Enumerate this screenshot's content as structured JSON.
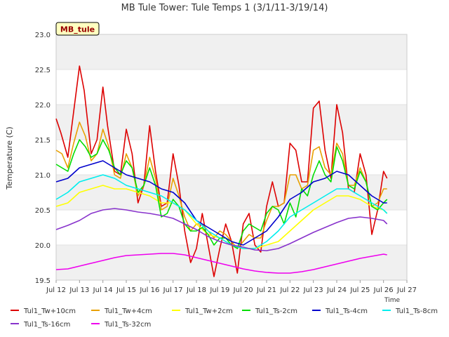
{
  "chart_data": {
    "type": "line",
    "title": "MB Tule Tower: Tule Temps 1 (3/1/11-3/19/14)",
    "xlabel": "Time",
    "ylabel": "Temperature (C)",
    "station_tag": "MB_tule",
    "xlim": [
      12,
      27
    ],
    "ylim": [
      19.5,
      23.0
    ],
    "x_ticks": [
      12,
      13,
      14,
      15,
      16,
      17,
      18,
      19,
      20,
      21,
      22,
      23,
      24,
      25,
      26,
      27
    ],
    "x_tick_labels": [
      "Jul 12",
      "Jul 13",
      "Jul 14",
      "Jul 15",
      "Jul 16",
      "Jul 17",
      "Jul 18",
      "Jul 19",
      "Jul 20",
      "Jul 21",
      "Jul 22",
      "Jul 23",
      "Jul 24",
      "Jul 25",
      "Jul 26",
      "Jul 27"
    ],
    "y_ticks": [
      19.5,
      20.0,
      20.5,
      21.0,
      21.5,
      22.0,
      22.5,
      23.0
    ],
    "y_tick_labels": [
      "19.5",
      "20.0",
      "20.5",
      "21.0",
      "21.5",
      "22.0",
      "22.5",
      "23.0"
    ],
    "grid": true,
    "legend_position": "bottom",
    "series": [
      {
        "name": "Tul1_Tw+10cm",
        "color": "#dd0000",
        "x": [
          12.0,
          12.2,
          12.5,
          12.75,
          13.0,
          13.2,
          13.5,
          13.75,
          14.0,
          14.2,
          14.5,
          14.75,
          15.0,
          15.25,
          15.5,
          15.75,
          16.0,
          16.25,
          16.5,
          16.75,
          17.0,
          17.25,
          17.5,
          17.75,
          18.0,
          18.25,
          18.5,
          18.75,
          19.0,
          19.25,
          19.5,
          19.75,
          20.0,
          20.25,
          20.5,
          20.75,
          21.0,
          21.25,
          21.5,
          21.75,
          22.0,
          22.25,
          22.5,
          22.75,
          23.0,
          23.25,
          23.5,
          23.75,
          24.0,
          24.25,
          24.5,
          24.75,
          25.0,
          25.25,
          25.5,
          25.75,
          26.0,
          26.15
        ],
        "y": [
          21.8,
          21.6,
          21.25,
          21.9,
          22.55,
          22.2,
          21.3,
          21.5,
          22.25,
          21.7,
          21.05,
          21.0,
          21.65,
          21.3,
          20.6,
          20.85,
          21.7,
          21.05,
          20.55,
          20.6,
          21.3,
          20.85,
          20.2,
          19.75,
          19.95,
          20.45,
          20.0,
          19.55,
          19.95,
          20.3,
          20.05,
          19.6,
          20.3,
          20.45,
          20.0,
          19.9,
          20.55,
          20.9,
          20.55,
          20.6,
          21.45,
          21.35,
          20.9,
          20.9,
          21.95,
          22.05,
          21.35,
          20.95,
          22.0,
          21.6,
          20.8,
          20.75,
          21.3,
          21.0,
          20.15,
          20.5,
          21.05,
          20.95
        ]
      },
      {
        "name": "Tul1_Tw+4cm",
        "color": "#e8a000",
        "x": [
          12.0,
          12.25,
          12.5,
          12.75,
          13.0,
          13.25,
          13.5,
          13.75,
          14.0,
          14.25,
          14.5,
          14.75,
          15.0,
          15.25,
          15.5,
          15.75,
          16.0,
          16.25,
          16.5,
          16.75,
          17.0,
          17.25,
          17.5,
          17.75,
          18.0,
          18.25,
          18.5,
          18.75,
          19.0,
          19.25,
          19.5,
          19.75,
          20.0,
          20.25,
          20.5,
          20.75,
          21.0,
          21.25,
          21.5,
          21.75,
          22.0,
          22.25,
          22.5,
          22.75,
          23.0,
          23.25,
          23.5,
          23.75,
          24.0,
          24.25,
          24.5,
          24.75,
          25.0,
          25.25,
          25.5,
          25.75,
          26.0,
          26.15
        ],
        "y": [
          21.35,
          21.3,
          21.1,
          21.45,
          21.75,
          21.55,
          21.2,
          21.3,
          21.65,
          21.4,
          21.0,
          20.95,
          21.3,
          21.1,
          20.7,
          20.85,
          21.25,
          20.95,
          20.5,
          20.55,
          20.95,
          20.7,
          20.4,
          20.2,
          20.3,
          20.3,
          20.2,
          20.1,
          20.2,
          20.15,
          20.05,
          19.95,
          20.05,
          20.15,
          20.1,
          20.1,
          20.35,
          20.55,
          20.55,
          20.6,
          21.0,
          21.0,
          20.8,
          20.85,
          21.35,
          21.4,
          21.1,
          21.0,
          21.45,
          21.3,
          20.85,
          20.85,
          21.1,
          20.9,
          20.55,
          20.6,
          20.8,
          20.8
        ]
      },
      {
        "name": "Tul1_Tw+2cm",
        "color": "#ffff00",
        "x": [
          12.0,
          12.5,
          13.0,
          13.5,
          14.0,
          14.5,
          15.0,
          15.5,
          16.0,
          16.5,
          17.0,
          17.5,
          18.0,
          18.5,
          19.0,
          19.5,
          20.0,
          20.5,
          21.0,
          21.5,
          22.0,
          22.5,
          23.0,
          23.5,
          24.0,
          24.5,
          25.0,
          25.5,
          26.0,
          26.15
        ],
        "y": [
          20.55,
          20.6,
          20.75,
          20.8,
          20.85,
          20.8,
          20.8,
          20.75,
          20.7,
          20.6,
          20.6,
          20.5,
          20.3,
          20.15,
          20.1,
          20.0,
          19.95,
          19.95,
          20.0,
          20.05,
          20.2,
          20.35,
          20.5,
          20.6,
          20.7,
          20.7,
          20.65,
          20.55,
          20.5,
          20.45
        ]
      },
      {
        "name": "Tul1_Ts-2cm",
        "color": "#00dd00",
        "x": [
          12.0,
          12.25,
          12.5,
          12.75,
          13.0,
          13.25,
          13.5,
          13.75,
          14.0,
          14.25,
          14.5,
          14.75,
          15.0,
          15.25,
          15.5,
          15.75,
          16.0,
          16.25,
          16.5,
          16.75,
          17.0,
          17.25,
          17.5,
          17.75,
          18.0,
          18.25,
          18.5,
          18.75,
          19.0,
          19.25,
          19.5,
          19.75,
          20.0,
          20.25,
          20.5,
          20.75,
          21.0,
          21.25,
          21.5,
          21.75,
          22.0,
          22.25,
          22.5,
          22.75,
          23.0,
          23.25,
          23.5,
          23.75,
          24.0,
          24.25,
          24.5,
          24.75,
          25.0,
          25.25,
          25.5,
          25.75,
          26.0,
          26.15
        ],
        "y": [
          21.15,
          21.1,
          21.05,
          21.3,
          21.5,
          21.4,
          21.25,
          21.3,
          21.5,
          21.35,
          21.1,
          21.0,
          21.2,
          21.1,
          20.75,
          20.85,
          21.1,
          20.85,
          20.4,
          20.45,
          20.65,
          20.55,
          20.3,
          20.2,
          20.2,
          20.25,
          20.15,
          20.0,
          20.1,
          20.1,
          20.0,
          19.95,
          20.2,
          20.3,
          20.25,
          20.2,
          20.45,
          20.55,
          20.5,
          20.3,
          20.6,
          20.4,
          20.8,
          20.7,
          21.0,
          21.2,
          21.0,
          20.9,
          21.4,
          21.2,
          20.85,
          20.8,
          21.05,
          20.9,
          20.55,
          20.5,
          20.6,
          20.65
        ]
      },
      {
        "name": "Tul1_Ts-4cm",
        "color": "#0000cc",
        "x": [
          12.0,
          12.5,
          13.0,
          13.5,
          14.0,
          14.5,
          15.0,
          15.5,
          16.0,
          16.5,
          17.0,
          17.5,
          18.0,
          18.5,
          19.0,
          19.5,
          20.0,
          20.5,
          21.0,
          21.5,
          22.0,
          22.5,
          23.0,
          23.5,
          24.0,
          24.5,
          25.0,
          25.5,
          26.0,
          26.15
        ],
        "y": [
          20.9,
          20.95,
          21.1,
          21.15,
          21.2,
          21.1,
          21.0,
          20.95,
          20.9,
          20.8,
          20.75,
          20.6,
          20.35,
          20.25,
          20.15,
          20.05,
          20.0,
          20.1,
          20.2,
          20.4,
          20.65,
          20.75,
          20.9,
          20.95,
          21.05,
          21.0,
          20.85,
          20.7,
          20.6,
          20.6
        ]
      },
      {
        "name": "Tul1_Ts-8cm",
        "color": "#00eeee",
        "x": [
          12.0,
          12.5,
          13.0,
          13.5,
          14.0,
          14.5,
          15.0,
          15.5,
          16.0,
          16.5,
          17.0,
          17.5,
          18.0,
          18.5,
          19.0,
          19.5,
          20.0,
          20.5,
          21.0,
          21.5,
          22.0,
          22.5,
          23.0,
          23.5,
          24.0,
          24.5,
          25.0,
          25.5,
          26.0,
          26.15
        ],
        "y": [
          20.65,
          20.75,
          20.9,
          20.95,
          21.0,
          20.95,
          20.85,
          20.8,
          20.75,
          20.7,
          20.6,
          20.5,
          20.35,
          20.2,
          20.1,
          20.0,
          19.95,
          19.95,
          20.05,
          20.2,
          20.4,
          20.5,
          20.6,
          20.7,
          20.8,
          20.8,
          20.7,
          20.6,
          20.5,
          20.45
        ]
      },
      {
        "name": "Tul1_Ts-16cm",
        "color": "#8833cc",
        "x": [
          12.0,
          12.5,
          13.0,
          13.5,
          14.0,
          14.5,
          15.0,
          15.5,
          16.0,
          16.5,
          17.0,
          17.5,
          18.0,
          18.5,
          19.0,
          19.5,
          20.0,
          20.5,
          21.0,
          21.5,
          22.0,
          22.5,
          23.0,
          23.5,
          24.0,
          24.5,
          25.0,
          25.5,
          26.0,
          26.15
        ],
        "y": [
          20.22,
          20.28,
          20.35,
          20.45,
          20.5,
          20.52,
          20.5,
          20.47,
          20.45,
          20.42,
          20.38,
          20.3,
          20.22,
          20.12,
          20.05,
          20.0,
          19.97,
          19.93,
          19.92,
          19.95,
          20.02,
          20.1,
          20.18,
          20.25,
          20.32,
          20.38,
          20.4,
          20.38,
          20.35,
          20.3
        ]
      },
      {
        "name": "Tul1_Ts-32cm",
        "color": "#ee00ee",
        "x": [
          12.0,
          12.5,
          13.0,
          13.5,
          14.0,
          14.5,
          15.0,
          15.5,
          16.0,
          16.5,
          17.0,
          17.5,
          18.0,
          18.5,
          19.0,
          19.5,
          20.0,
          20.5,
          21.0,
          21.5,
          22.0,
          22.5,
          23.0,
          23.5,
          24.0,
          24.5,
          25.0,
          25.5,
          26.0,
          26.15
        ],
        "y": [
          19.65,
          19.66,
          19.7,
          19.74,
          19.78,
          19.82,
          19.85,
          19.86,
          19.87,
          19.88,
          19.88,
          19.86,
          19.82,
          19.78,
          19.74,
          19.7,
          19.66,
          19.63,
          19.61,
          19.6,
          19.6,
          19.62,
          19.65,
          19.69,
          19.73,
          19.77,
          19.81,
          19.84,
          19.87,
          19.86
        ]
      }
    ]
  }
}
